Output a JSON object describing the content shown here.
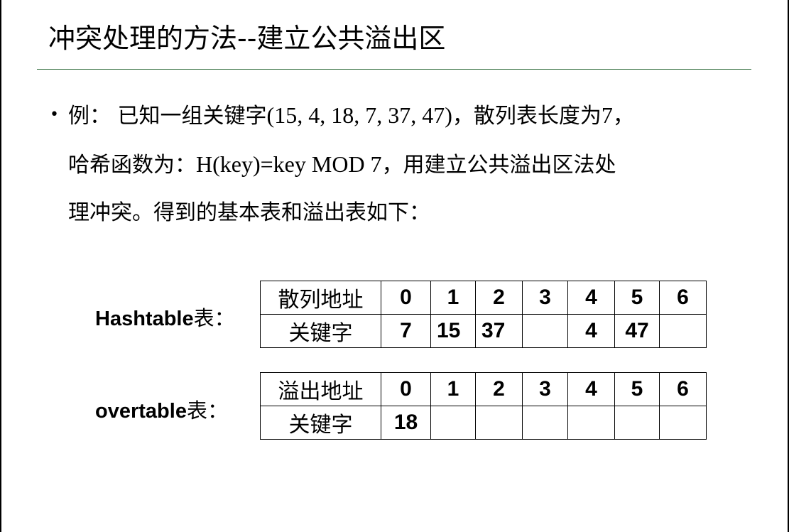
{
  "title": "冲突处理的方法--建立公共溢出区",
  "bullet": "•",
  "paragraph": {
    "l1a": "例：  已知一组关键字",
    "l1b": "(15, 4, 18, 7, 37, 47)",
    "l1c": "，散列表长度为",
    "l1d": "7",
    "l1e": "，",
    "l2a": "哈希函数为：",
    "l2b": "H(key)=key MOD 7",
    "l2c": "，用建立公共溢出区法处",
    "l3": "理冲突。得到的基本表和溢出表如下："
  },
  "hashtable": {
    "label_en": "Hashtable",
    "label_cn": "表：",
    "header_label": "散列地址",
    "header_cells": [
      "0",
      "1",
      "2",
      "3",
      "4",
      "5",
      "6"
    ],
    "row_label": "关键字",
    "row_cells": [
      "7",
      "15",
      "37",
      "",
      "4",
      "47",
      ""
    ]
  },
  "overtable": {
    "label_en": "overtable",
    "label_cn": "表：",
    "header_label": "溢出地址",
    "header_cells": [
      "0",
      "1",
      "2",
      "3",
      "4",
      "5",
      "6"
    ],
    "row_label": "关键字",
    "row_cells": [
      "18",
      "",
      "",
      "",
      "",
      "",
      ""
    ]
  }
}
